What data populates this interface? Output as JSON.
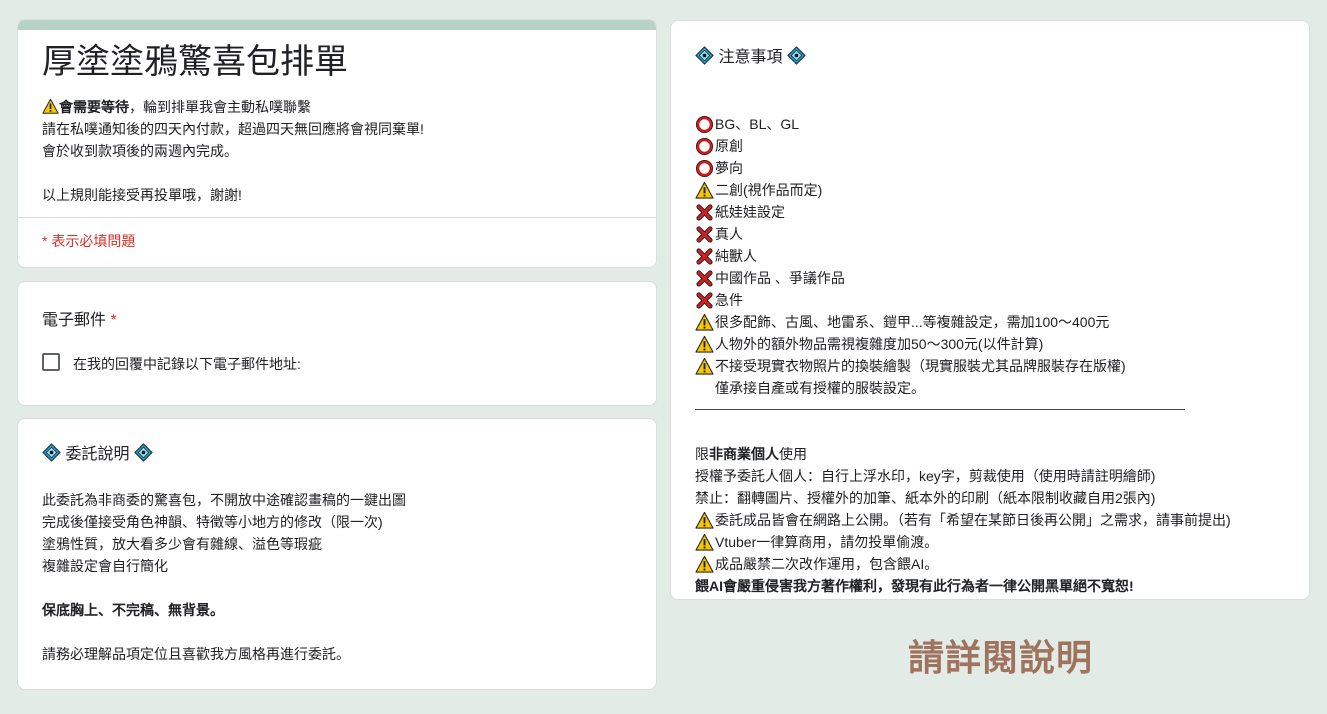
{
  "form": {
    "title": "厚塗塗鴉驚喜包排單",
    "description": {
      "warning_bold": "會需要等待",
      "warning_rest": "，輪到排單我會主動私噗聯繫",
      "lines": [
        "請在私噗通知後的四天內付款，超過四天無回應將會視同棄單!",
        "會於收到款項後的兩週內完成。",
        "",
        "以上規則能接受再投單哦，謝謝!"
      ]
    },
    "required_note": "* 表示必填問題"
  },
  "email": {
    "label": "電子郵件",
    "required_mark": "*",
    "checkbox_label": "在我的回覆中記錄以下電子郵件地址:"
  },
  "commission": {
    "heading": "委託說明",
    "lines": [
      "此委託為非商委的驚喜包，不開放中途確認畫稿的一鍵出圖",
      "完成後僅接受角色神韻、特徵等小地方的修改（限一次)",
      "塗鴉性質，放大看多少會有雜線、溢色等瑕疵",
      "複雜設定會自行簡化"
    ],
    "bold_line": "保底胸上、不完稿、無背景。",
    "closing": "請務必理解品項定位且喜歡我方風格再進行委託。"
  },
  "notes": {
    "heading": "注意事項",
    "items": [
      {
        "icon": "circle-ok-icon",
        "text": "BG、BL、GL"
      },
      {
        "icon": "circle-ok-icon",
        "text": "原創"
      },
      {
        "icon": "circle-ok-icon",
        "text": "夢向"
      },
      {
        "icon": "warning-icon",
        "text": "二創(視作品而定)"
      },
      {
        "icon": "cross-icon",
        "text": "紙娃娃設定"
      },
      {
        "icon": "cross-icon",
        "text": "真人"
      },
      {
        "icon": "cross-icon",
        "text": "純獸人"
      },
      {
        "icon": "cross-icon",
        "text": "中國作品 、爭議作品"
      },
      {
        "icon": "cross-icon",
        "text": "急件"
      },
      {
        "icon": "warning-icon",
        "text": "很多配飾、古風、地雷系、鎧甲...等複雜設定，需加100～400元"
      },
      {
        "icon": "warning-icon",
        "text": "人物外的額外物品需視複雜度加50～300元(以件計算)"
      },
      {
        "icon": "warning-icon",
        "text": "不接受現實衣物照片的換裝繪製（現實服裝尤其品牌服裝存在版權)"
      },
      {
        "icon": "",
        "text": "僅承接自產或有授權的服裝設定。"
      }
    ],
    "usage_prefix": "限",
    "usage_bold": "非商業個人",
    "usage_suffix": "使用",
    "usage_lines": [
      "授權予委託人個人：自行上浮水印，key字，剪裁使用（使用時請註明繪師)",
      "禁止：翻轉圖片、授權外的加筆、紙本外的印刷（紙本限制收藏自用2張內)"
    ],
    "warnings": [
      "委託成品皆會在網路上公開。（若有「希望在某節日後再公開」之需求，請事前提出)",
      "Vtuber一律算商用，請勿投單偷渡。",
      "成品嚴禁二次改作運用，包含餵AI。"
    ],
    "final_bold": "餵AI會嚴重侵害我方著作權利，發現有此行為者一律公開黑單絕不寬恕!"
  },
  "footer": {
    "stamp": "請詳閱說明"
  },
  "colors": {
    "accent_bar": "#b7d2c6",
    "required": "#d93025",
    "stamp": "#a0735e",
    "background": "#e2ebe6"
  }
}
